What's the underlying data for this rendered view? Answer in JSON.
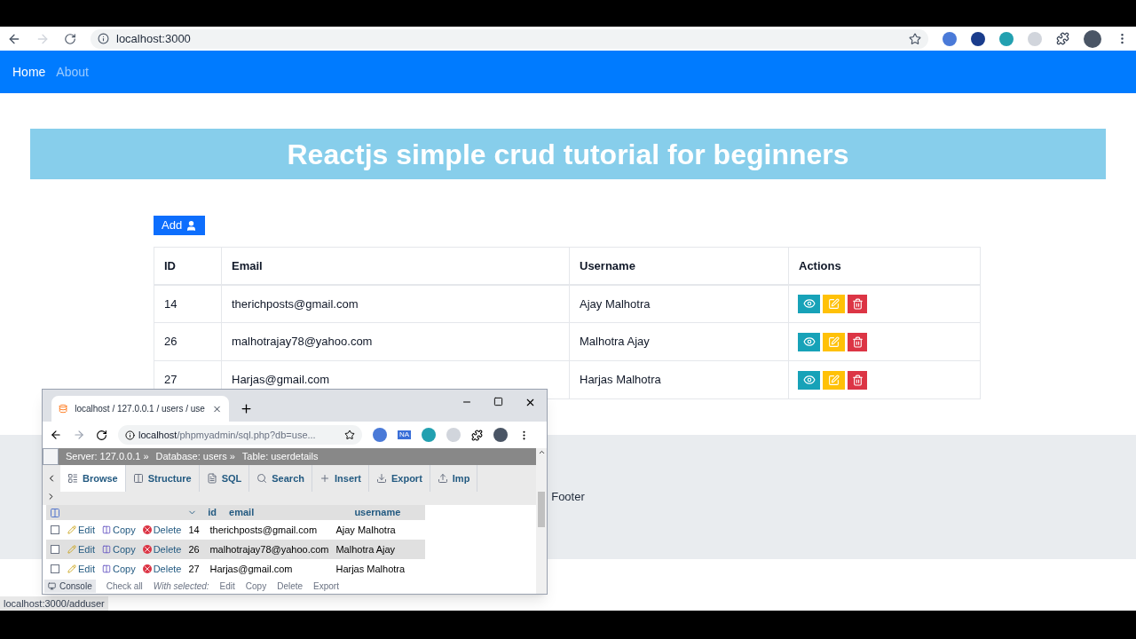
{
  "browser": {
    "url": "localhost:3000"
  },
  "nav": [
    {
      "label": "Home",
      "selected": true
    },
    {
      "label": "About",
      "selected": false
    }
  ],
  "title": "Reactjs simple crud tutorial for beginners",
  "add_button": "Add",
  "table": {
    "columns": [
      "ID",
      "Email",
      "Username",
      "Actions"
    ],
    "rows": [
      {
        "id": "14",
        "email": "therichposts@gmail.com",
        "username": "Ajay Malhotra"
      },
      {
        "id": "26",
        "email": "malhotrajay78@yahoo.com",
        "username": "Malhotra Ajay"
      },
      {
        "id": "27",
        "email": "Harjas@gmail.com",
        "username": "Harjas Malhotra"
      }
    ]
  },
  "footer": "Footer",
  "status_url": "localhost:3000/adduser",
  "popup": {
    "tab_title": "localhost / 127.0.0.1 / users / use",
    "url_host": "localhost",
    "url_path": "/phpmyadmin/sql.php?db=use...",
    "ext_badge": "NA",
    "breadcrumb": [
      "Server: 127.0.0.1 »",
      "Database: users »",
      "Table: userdetails"
    ],
    "tabs": [
      {
        "label": "Browse",
        "selected": true
      },
      {
        "label": "Structure",
        "selected": false
      },
      {
        "label": "SQL",
        "selected": false
      },
      {
        "label": "Search",
        "selected": false
      },
      {
        "label": "Insert",
        "selected": false
      },
      {
        "label": "Export",
        "selected": false
      },
      {
        "label": "Imp",
        "selected": false
      }
    ],
    "columns": [
      "id",
      "email",
      "username"
    ],
    "rows": [
      {
        "actions": [
          "Edit",
          "Copy",
          "Delete"
        ],
        "id": "14",
        "email": "therichposts@gmail.com",
        "username": "Ajay Malhotra",
        "selected": false
      },
      {
        "actions": [
          "Edit",
          "Copy",
          "Delete"
        ],
        "id": "26",
        "email": "malhotrajay78@yahoo.com",
        "username": "Malhotra Ajay",
        "selected": true
      },
      {
        "actions": [
          "Edit",
          "Copy",
          "Delete"
        ],
        "id": "27",
        "email": "Harjas@gmail.com",
        "username": "Harjas Malhotra",
        "selected": false
      }
    ],
    "console": "Console",
    "bottom": [
      "Check all",
      "With selected:",
      "Edit",
      "Copy",
      "Delete",
      "Export"
    ]
  }
}
